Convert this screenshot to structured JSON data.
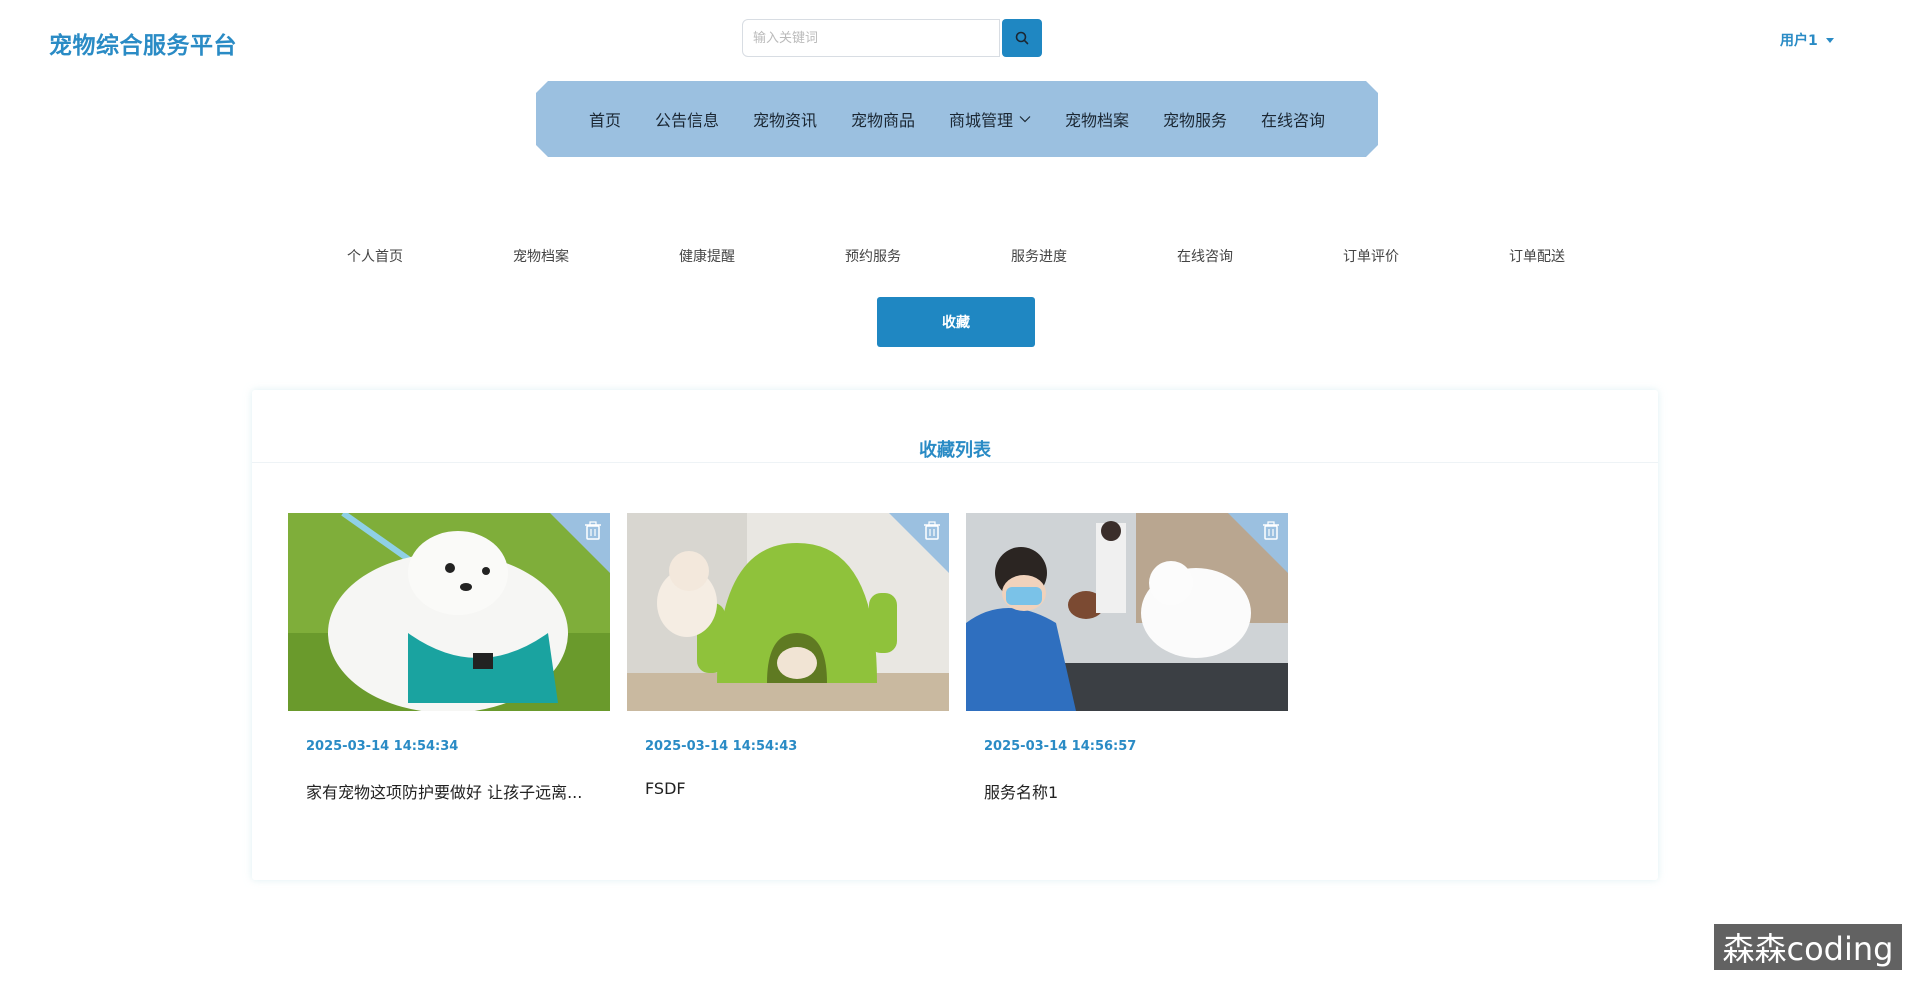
{
  "header": {
    "logo": "宠物综合服务平台",
    "search": {
      "placeholder": "输入关键词",
      "value": ""
    },
    "search_icon": "search-icon",
    "user": "用户1"
  },
  "nav": {
    "items": [
      {
        "label": "首页"
      },
      {
        "label": "公告信息"
      },
      {
        "label": "宠物资讯"
      },
      {
        "label": "宠物商品"
      },
      {
        "label": "商城管理",
        "dropdown": true
      },
      {
        "label": "宠物档案"
      },
      {
        "label": "宠物服务"
      },
      {
        "label": "在线咨询"
      }
    ]
  },
  "subnav": {
    "items": [
      "个人首页",
      "宠物档案",
      "健康提醒",
      "预约服务",
      "服务进度",
      "在线咨询",
      "订单评价",
      "订单配送"
    ]
  },
  "favorites_button": "收藏",
  "panel": {
    "title": "收藏列表",
    "cards": [
      {
        "date": "2025-03-14 14:54:34",
        "title": "家有宠物这项防护要做好 让孩子远离..."
      },
      {
        "date": "2025-03-14 14:54:43",
        "title": "FSDF"
      },
      {
        "date": "2025-03-14 14:56:57",
        "title": "服务名称1"
      }
    ]
  },
  "watermark": "森森coding",
  "colors": {
    "brand": "#2a8bc5",
    "nav_bg": "#9bc0e0",
    "button": "#1f87c2"
  }
}
